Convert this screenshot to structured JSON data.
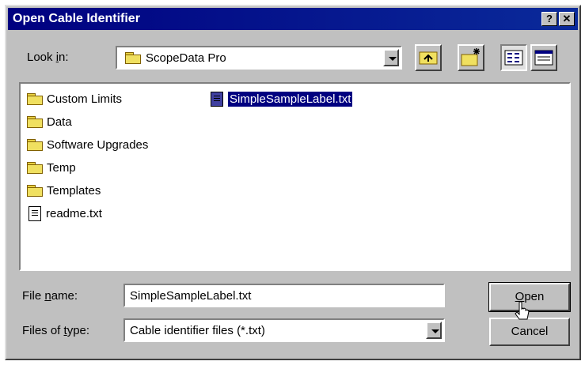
{
  "window": {
    "title": "Open Cable Identifier",
    "help_label": "?",
    "close_label": "✕"
  },
  "look_in": {
    "label_pre": "Look ",
    "label_underlined": "i",
    "label_post": "n:",
    "value": "ScopeData Pro"
  },
  "toolbar": {
    "up_folder": "up-one-level-icon",
    "new_folder": "new-folder-icon",
    "list_view": "list-view-icon",
    "details_view": "details-view-icon"
  },
  "files": [
    {
      "name": "Custom Limits",
      "type": "folder"
    },
    {
      "name": "Data",
      "type": "folder"
    },
    {
      "name": "Software Upgrades",
      "type": "folder"
    },
    {
      "name": "Temp",
      "type": "folder"
    },
    {
      "name": "Templates",
      "type": "folder"
    },
    {
      "name": "readme.txt",
      "type": "file"
    },
    {
      "name": "SimpleSampleLabel.txt",
      "type": "file",
      "selected": true
    }
  ],
  "file_name": {
    "label_pre": "File ",
    "label_underlined": "n",
    "label_post": "ame:",
    "value": "SimpleSampleLabel.txt"
  },
  "file_type": {
    "label_pre": "Files of ",
    "label_underlined": "t",
    "label_post": "ype:",
    "value": "Cable identifier files (*.txt)"
  },
  "buttons": {
    "open_underlined": "O",
    "open_rest": "pen",
    "cancel": "Cancel"
  }
}
